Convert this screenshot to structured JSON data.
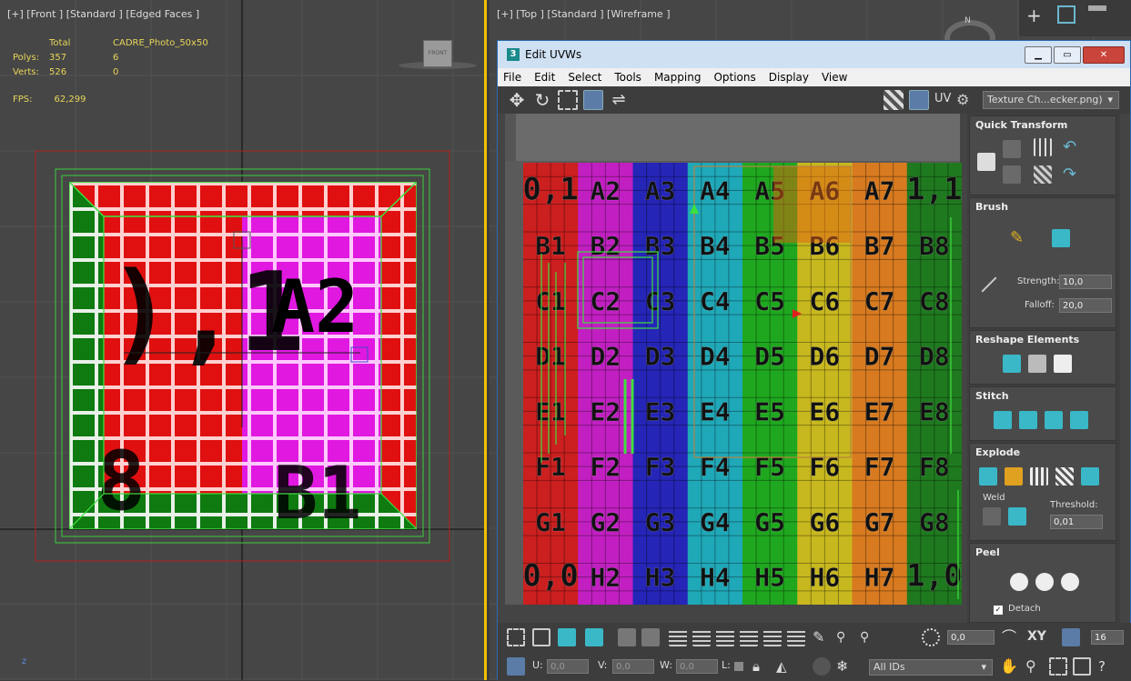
{
  "front_viewport": {
    "label": "[+] [Front ] [Standard ] [Edged Faces ]",
    "stats": {
      "header": [
        "",
        "Total",
        "CADRE_Photo_50x50"
      ],
      "rows": [
        [
          "Polys:",
          "357",
          "6"
        ],
        [
          "Verts:",
          "526",
          "0"
        ]
      ],
      "fps_label": "FPS:",
      "fps_value": "62,299"
    },
    "navcube_label": "FRONT",
    "axis_z": "z"
  },
  "top_viewport": {
    "label": "[+] [Top ] [Standard ] [Wireframe ]",
    "compass_letter": "N"
  },
  "uvw_window": {
    "title": "Edit UVWs",
    "app_icon_label": "3",
    "menu": [
      "File",
      "Edit",
      "Select",
      "Tools",
      "Mapping",
      "Options",
      "Display",
      "View"
    ],
    "uv_label": "UV",
    "texture_combo": "Texture Ch...ecker.png)",
    "checker": {
      "rows": [
        [
          "0,1",
          "A2",
          "A3",
          "A4",
          "A5",
          "A6",
          "A7",
          "1,1"
        ],
        [
          "B1",
          "B2",
          "B3",
          "B4",
          "B5",
          "B6",
          "B7",
          "B8"
        ],
        [
          "C1",
          "C2",
          "C3",
          "C4",
          "C5",
          "C6",
          "C7",
          "C8"
        ],
        [
          "D1",
          "D2",
          "D3",
          "D4",
          "D5",
          "D6",
          "D7",
          "D8"
        ],
        [
          "E1",
          "E2",
          "E3",
          "E4",
          "E5",
          "E6",
          "E7",
          "E8"
        ],
        [
          "F1",
          "F2",
          "F3",
          "F4",
          "F5",
          "F6",
          "F7",
          "F8"
        ],
        [
          "G1",
          "G2",
          "G3",
          "G4",
          "G5",
          "G6",
          "G7",
          "G8"
        ],
        [
          "0,0",
          "H2",
          "H3",
          "H4",
          "H5",
          "H6",
          "H7",
          "1,0"
        ]
      ],
      "column_colors": [
        "#cc1f1f",
        "#c21fc2",
        "#2525b8",
        "#1fa8b8",
        "#1fa81f",
        "#c8b81f",
        "#d87a1f",
        "#1f7a1f"
      ]
    },
    "panels": {
      "quick_transform": "Quick Transform",
      "brush": "Brush",
      "strength_label": "Strength:",
      "strength_value": "10,0",
      "falloff_label": "Falloff:",
      "falloff_value": "20,0",
      "reshape": "Reshape Elements",
      "stitch": "Stitch",
      "explode": "Explode",
      "weld": "Weld",
      "threshold_label": "Threshold:",
      "threshold_value": "0,01",
      "peel": "Peel",
      "detach": "Detach"
    },
    "bottom": {
      "spinner_value": "0,0",
      "xy_label": "XY",
      "count_value": "16",
      "u_label": "U:",
      "u_value": "0,0",
      "v_label": "V:",
      "v_value": "0,0",
      "w_label": "W:",
      "w_value": "0,0",
      "l_label": "L:",
      "ids_combo": "All IDs"
    }
  }
}
